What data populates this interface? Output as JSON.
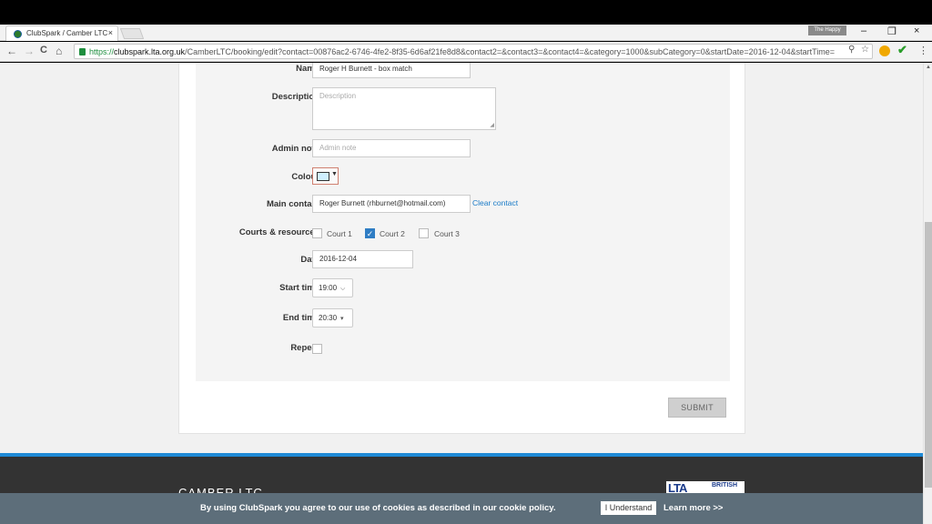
{
  "browser": {
    "tab_title": "ClubSpark / Camber LTC",
    "tab_close": "×",
    "profile_name": "The Happy",
    "minimize": "–",
    "restore": "❐",
    "close": "×",
    "back_icon": "←",
    "forward_icon": "→",
    "reload_icon": "C",
    "home_icon": "⌂",
    "url_scheme": "https://",
    "url_domain": "clubspark.lta.org.uk",
    "url_path": "/CamberLTC/booking/edit?contact=00876ac2-6746-4fe2-8f35-6d6af21fe8d8&contact2=&contact3=&contact4=&category=1000&subCategory=0&startDate=2016-12-04&startTime=",
    "zoom_icon": "⚲",
    "star_icon": "☆",
    "check_icon": "✔",
    "menu_icon": "⋮"
  },
  "form": {
    "name_label": "Name",
    "name_value": "Roger H Burnett - box match",
    "description_label": "Description",
    "description_placeholder": "Description",
    "admin_note_label": "Admin note",
    "admin_note_placeholder": "Admin note",
    "colour_label": "Colour",
    "colour_value": "#cfefff",
    "colour_arrow": "▼",
    "main_contact_label": "Main contact",
    "main_contact_value": "Roger Burnett (rhburnet@hotmail.com)",
    "clear_contact": "Clear contact",
    "courts_label": "Courts & resources",
    "courts": [
      {
        "label": "Court 1",
        "checked": false
      },
      {
        "label": "Court 2",
        "checked": true
      },
      {
        "label": "Court 3",
        "checked": false
      }
    ],
    "checkmark": "✓",
    "date_label": "Date",
    "date_value": "2016-12-04",
    "start_time_label": "Start time",
    "start_time_value": "19:00",
    "start_time_arrow": "⌵",
    "end_time_label": "End time",
    "end_time_value": "20:30",
    "end_time_arrow": "▾",
    "repeat_label": "Repeat",
    "submit_label": "SUBMIT"
  },
  "footer": {
    "club_name": "CAMBER LTC",
    "logo_text": "LTA",
    "logo_sub": "BRITISH"
  },
  "cookie": {
    "message": "By using ClubSpark you agree to our use of cookies as described in our cookie policy.",
    "understand": "I Understand",
    "learn_more": "Learn more >>"
  }
}
